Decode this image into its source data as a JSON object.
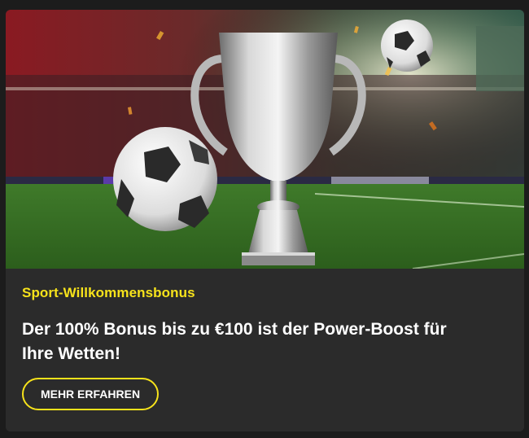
{
  "promo": {
    "kicker": "Sport-Willkommensbonus",
    "headline": "Der 100% Bonus bis zu €100 ist der Power-Boost für Ihre Wetten!",
    "cta_label": "MEHR ERFAHREN"
  },
  "colors": {
    "accent": "#f7e31b",
    "card_bg": "#2b2b2b",
    "page_bg": "#1c1c1c",
    "text": "#ffffff"
  },
  "hero": {
    "icons": [
      "trophy-icon",
      "soccer-ball-icon"
    ]
  }
}
